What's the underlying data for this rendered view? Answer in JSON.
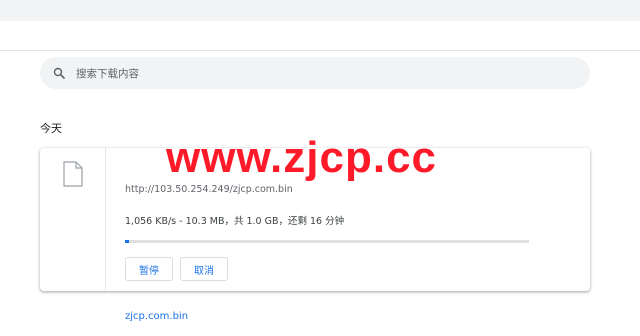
{
  "search": {
    "placeholder": "搜索下载内容"
  },
  "section": {
    "title": "今天"
  },
  "download": {
    "filename": "zjcp.com.bin",
    "url": "http://103.50.254.249/zjcp.com.bin",
    "status": "1,056 KB/s - 10.3 MB，共 1.0 GB，还剩 16 分钟",
    "progress_fraction": 0.01,
    "pause_label": "暂停",
    "cancel_label": "取消"
  },
  "watermark": {
    "text": "www.zjcp.cc"
  },
  "colors": {
    "accent": "#1a73e8",
    "watermark": "#ff1a2a",
    "search_bg": "#f1f3f4"
  },
  "icons": {
    "search": "search-icon",
    "file": "file-icon"
  }
}
